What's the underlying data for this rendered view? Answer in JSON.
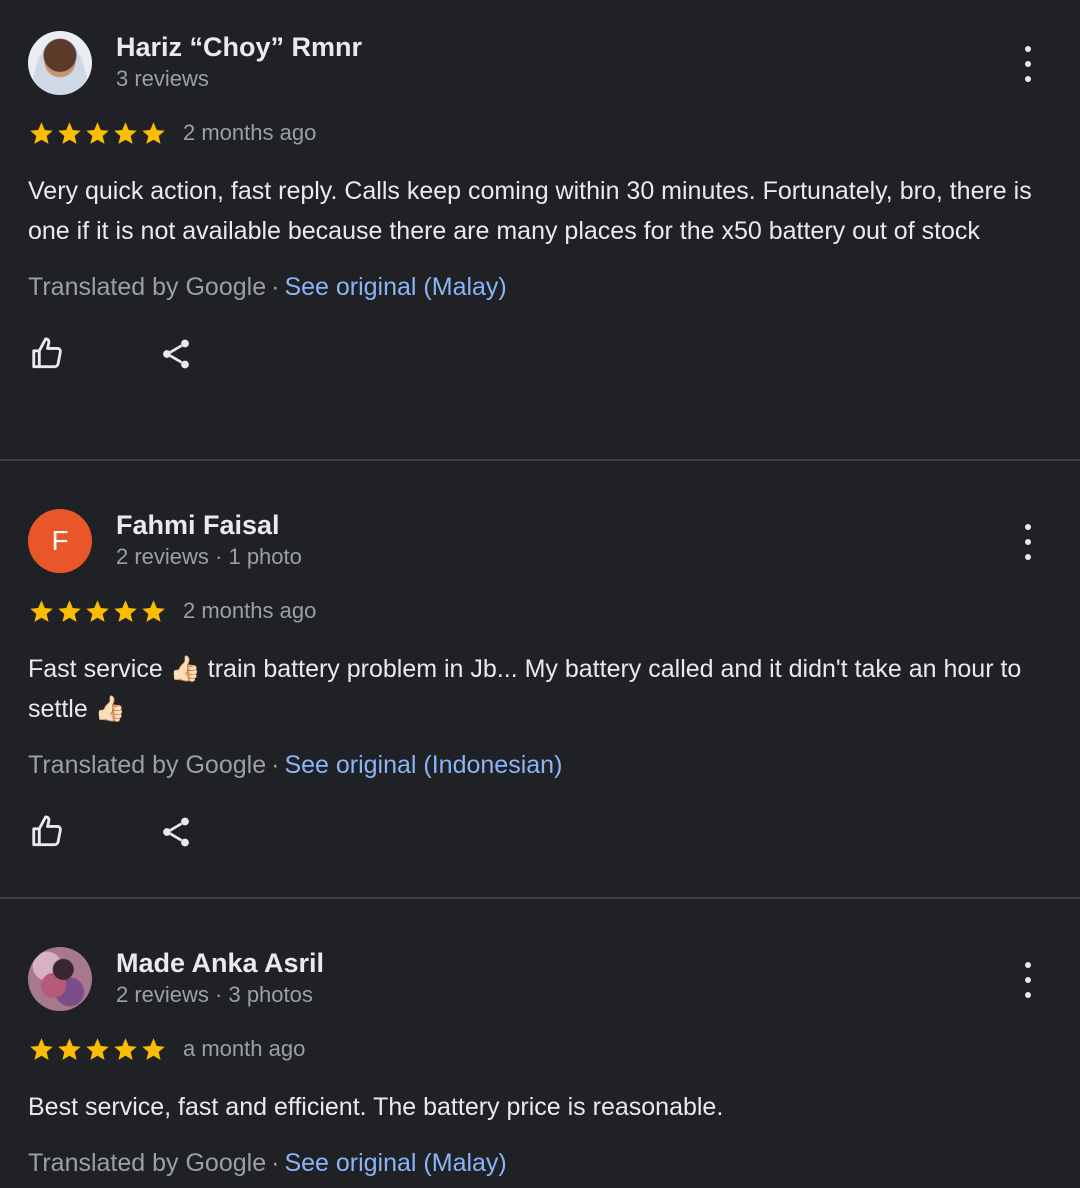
{
  "reviews": [
    {
      "author": "Hariz “Choy” Rmnr",
      "meta": "3 reviews",
      "avatar_letter": "",
      "rating": 5,
      "date": "2 months ago",
      "text": "Very quick action, fast reply. Calls keep coming within 30 minutes. Fortunately, bro, there is one if it is not available because there are many places for the x50 battery out of stock",
      "translated_by": "Translated by Google",
      "see_original": "See original (Malay)"
    },
    {
      "author": "Fahmi Faisal",
      "meta": "2 reviews · 1 photo",
      "avatar_letter": "F",
      "rating": 5,
      "date": "2 months ago",
      "text_part1": "Fast service ",
      "emoji": "👍🏻",
      "text_part2": " train battery problem in Jb... My battery called and it didn't take an hour to settle ",
      "translated_by": "Translated by Google",
      "see_original": "See original (Indonesian)"
    },
    {
      "author": "Made Anka Asril",
      "meta": "2 reviews · 3 photos",
      "avatar_letter": "",
      "rating": 5,
      "date": "a month ago",
      "text": "Best service, fast and efficient. The battery price is reasonable.",
      "translated_by": "Translated by Google",
      "see_original": "See original (Malay)"
    }
  ],
  "separator": "·",
  "colors": {
    "background": "#202124",
    "star": "#fbbc04",
    "link": "#8ab4f8",
    "avatar_letter_bg": "#e8562a",
    "divider": "#3c4043"
  },
  "icons": {
    "like": "thumb-up-icon",
    "share": "share-icon",
    "more": "more-vert-icon",
    "star": "star-icon"
  }
}
